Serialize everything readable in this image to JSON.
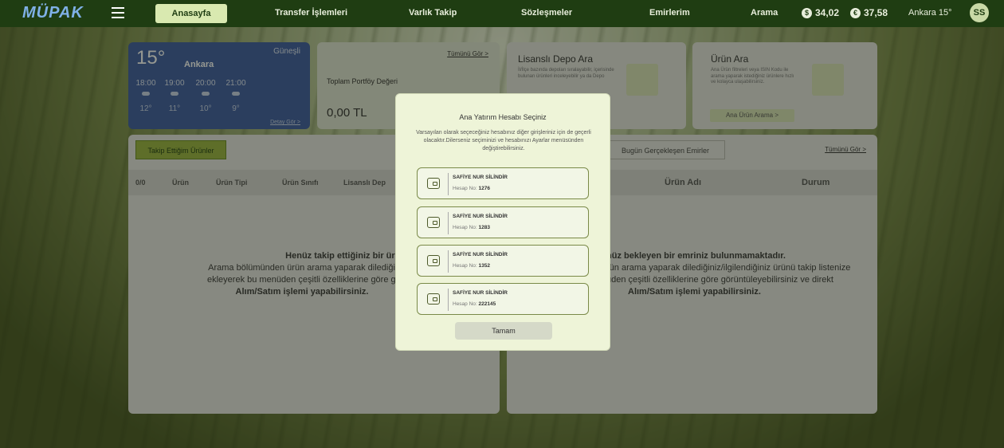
{
  "nav": {
    "logo": "MÜPAK",
    "items": [
      "Anasayfa",
      "Transfer İşlemleri",
      "Varlık Takip",
      "Sözleşmeler",
      "Emirlerim",
      "Arama"
    ],
    "currency1": "34,02",
    "currency2": "37,58",
    "location": "Ankara 15°",
    "avatar": "SS"
  },
  "weather": {
    "temp": "15°",
    "city": "Ankara",
    "condition": "Güneşli",
    "hours": [
      "18:00",
      "19:00",
      "20:00",
      "21:00"
    ],
    "degrees": [
      "12°",
      "11°",
      "10°",
      "9°"
    ],
    "detail": "Detay Gör >"
  },
  "portfolio": {
    "all": "Tümünü Gör >",
    "label": "Toplam Portföy Değeri",
    "value": "0,00 TL"
  },
  "depo": {
    "title": "Lisanslı Depo Ara",
    "text": "İl/İlçe bazında depoları sıralayabilir, içerisinde bulunan ürünleri inceleyebilir ya da Depo"
  },
  "urun_ara": {
    "title": "Ürün Ara",
    "text": "Ana Ürün filtreleri veya ISIN Kodu ile arama yaparak istediğiniz ürünlere hızlı ve kolayca ulaşabilirsiniz.",
    "button": "Ana Ürün Arama >"
  },
  "follow": {
    "tab": "Takip Ettiğim Ürünler",
    "headers": [
      "0/0",
      "Ürün",
      "Ürün Tipi",
      "Ürün Sınıfı",
      "Lisanslı Dep"
    ],
    "empty_line1": "Henüz takip ettiğiniz bir ürün bulunmamakta",
    "empty_line2": "Arama bölümünden ürün arama yaparak dilediğiniz/ilgilendiğini",
    "empty_line3": "ekleyerek bu menüden çeşitli özelliklerine göre görüntüleye",
    "empty_line4": "Alım/Satım işlemi yapabilirsiniz."
  },
  "orders": {
    "tab": "Bugün Gerçekleşen Emirler",
    "all": "Tümünü Gör >",
    "headers": [
      "Ürün Adı",
      "Durum"
    ],
    "empty_line1": "nüz bekleyen bir emriniz bulunmamaktadır.",
    "empty_line2": "rün arama yaparak dilediğiniz/ilgilendiğiniz ürünü takip listenize",
    "empty_line3": "üden çeşitli özelliklerine göre görüntüleyebilirsiniz ve direkt",
    "empty_line4": "Alım/Satım işlemi yapabilirsiniz."
  },
  "modal": {
    "title": "Ana Yatırım Hesabı Seçiniz",
    "description": "Varsayılan olarak seçeceğiniz hesabınız diğer girişleriniz için de geçerli olacaktır.Dilerseniz seçiminizi ve hesabınızı Ayarlar menüsünden değiştirebilirsiniz.",
    "accounts": [
      {
        "name": "SAFİYE NUR SİLİNDİR",
        "label": "Hesap No:",
        "no": "1276"
      },
      {
        "name": "SAFİYE NUR SİLİNDİR",
        "label": "Hesap No:",
        "no": "1283"
      },
      {
        "name": "SAFİYE NUR SİLİNDİR",
        "label": "Hesap No:",
        "no": "1352"
      },
      {
        "name": "SAFİYE NUR SİLİNDİR",
        "label": "Hesap No:",
        "no": "222145"
      }
    ],
    "button": "Tamam"
  }
}
